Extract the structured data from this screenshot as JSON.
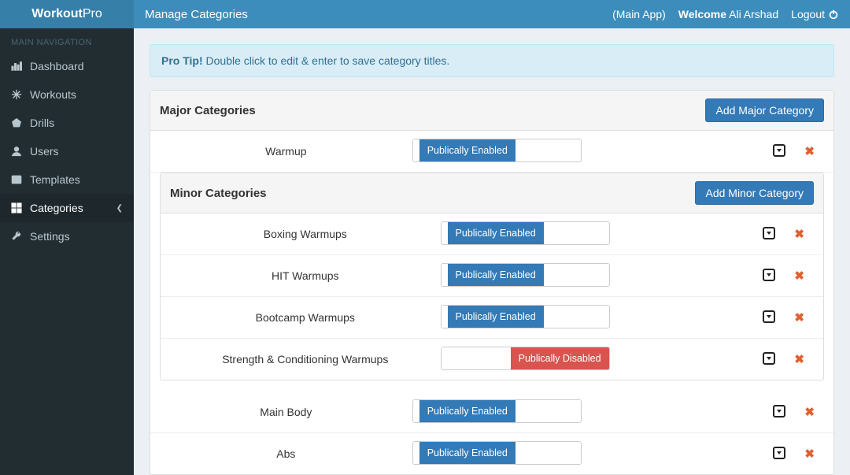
{
  "brand": {
    "bold": "Workout",
    "light": "Pro"
  },
  "header": {
    "title": "Manage Categories",
    "main_app": "(Main App)",
    "welcome_label": "Welcome",
    "user_name": "Ali Arshad",
    "logout": "Logout"
  },
  "sidebar": {
    "heading": "MAIN NAVIGATION",
    "items": [
      {
        "label": "Dashboard",
        "icon": "bar-chart-icon"
      },
      {
        "label": "Workouts",
        "icon": "snowflake-icon"
      },
      {
        "label": "Drills",
        "icon": "pentagon-icon"
      },
      {
        "label": "Users",
        "icon": "user-icon"
      },
      {
        "label": "Templates",
        "icon": "templates-icon"
      },
      {
        "label": "Categories",
        "icon": "categories-icon",
        "active": true,
        "chevron": true
      },
      {
        "label": "Settings",
        "icon": "wrench-icon"
      }
    ]
  },
  "tip": {
    "bold": "Pro Tip!",
    "text": "Double click to edit & enter to save category titles."
  },
  "major": {
    "heading": "Major Categories",
    "add_label": "Add Major Category",
    "rows": [
      {
        "name": "Warmup",
        "status": "Publically Enabled",
        "enabled": true
      },
      {
        "name": "Main Body",
        "status": "Publically Enabled",
        "enabled": true
      },
      {
        "name": "Abs",
        "status": "Publically Enabled",
        "enabled": true
      }
    ]
  },
  "minor": {
    "heading": "Minor Categories",
    "add_label": "Add Minor Category",
    "rows": [
      {
        "name": "Boxing Warmups",
        "status": "Publically Enabled",
        "enabled": true
      },
      {
        "name": "HIT Warmups",
        "status": "Publically Enabled",
        "enabled": true
      },
      {
        "name": "Bootcamp Warmups",
        "status": "Publically Enabled",
        "enabled": true
      },
      {
        "name": "Strength & Conditioning Warmups",
        "status": "Publically Disabled",
        "enabled": false
      }
    ]
  }
}
